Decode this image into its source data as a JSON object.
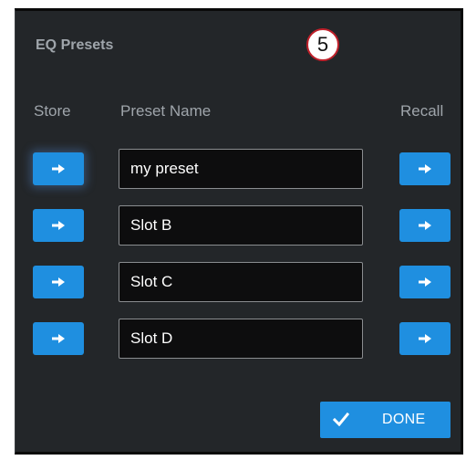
{
  "dialog": {
    "title": "EQ Presets",
    "step_badge": "5"
  },
  "columns": {
    "store": "Store",
    "preset_name": "Preset Name",
    "recall": "Recall"
  },
  "presets": [
    {
      "name": "my preset"
    },
    {
      "name": "Slot B"
    },
    {
      "name": "Slot C"
    },
    {
      "name": "Slot D"
    }
  ],
  "done_button": {
    "label": "DONE"
  },
  "icons": {
    "store": "arrow-right-icon",
    "recall": "arrow-right-icon",
    "done": "check-icon"
  },
  "colors": {
    "accent": "#1f8fe0",
    "panel_background": "#232629",
    "field_background": "#0d0d0e",
    "header_text": "#9fa5ab",
    "badge_border": "#c0202a"
  }
}
